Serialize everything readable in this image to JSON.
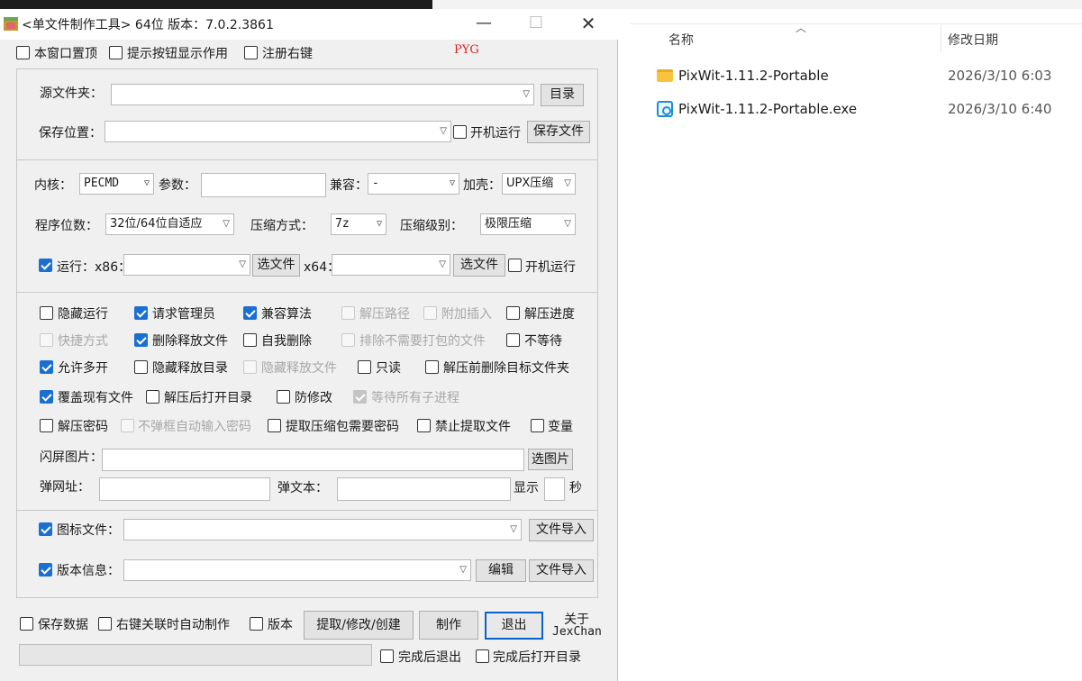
{
  "window": {
    "title": "<单文件制作工具> 64位 版本：7.0.2.3861",
    "brand_mark": "PYG"
  },
  "top_options": {
    "always_on_top": {
      "label": "本窗口置顶",
      "checked": false
    },
    "show_tips": {
      "label": "提示按钮显示作用",
      "checked": false
    },
    "register_context": {
      "label": "注册右键",
      "checked": false
    }
  },
  "source": {
    "source_folder_label": "源文件夹：",
    "source_folder_value": "",
    "dir_button": "目录",
    "save_location_label": "保存位置：",
    "save_location_value": "",
    "autorun_label": "开机运行",
    "save_file_button": "保存文件"
  },
  "settings": {
    "kernel_label": "内核：",
    "kernel_value": "PECMD",
    "params_label": "参数：",
    "compat_label": "兼容：",
    "compat_value": "-",
    "pack_label": "加壳：",
    "pack_value": "UPX压缩",
    "bits_label": "程序位数：",
    "bits_value": "32位/64位自适应",
    "compress_method_label": "压缩方式：",
    "compress_method_value": "7z",
    "compress_level_label": "压缩级别：",
    "compress_level_value": "极限压缩",
    "run_label": "运行：x86：",
    "run_checked": true,
    "choose_file_x86": "选文件",
    "x64_label": "x64：",
    "choose_file_x64": "选文件",
    "boot_run_label": "开机运行"
  },
  "options": {
    "row1": [
      {
        "label": "隐藏运行",
        "state": "off"
      },
      {
        "label": "请求管理员",
        "state": "on"
      },
      {
        "label": "兼容算法",
        "state": "on"
      },
      {
        "label": "解压路径",
        "state": "disabled"
      },
      {
        "label": "附加插入",
        "state": "disabled"
      },
      {
        "label": "解压进度",
        "state": "off"
      }
    ],
    "row2": [
      {
        "label": "快捷方式",
        "state": "disabled"
      },
      {
        "label": "删除释放文件",
        "state": "on"
      },
      {
        "label": "自我删除",
        "state": "off"
      },
      {
        "label": "排除不需要打包的文件",
        "state": "disabled"
      },
      {
        "label": "不等待",
        "state": "off"
      }
    ],
    "row3": [
      {
        "label": "允许多开",
        "state": "on"
      },
      {
        "label": "隐藏释放目录",
        "state": "off"
      },
      {
        "label": "隐藏释放文件",
        "state": "disabled"
      },
      {
        "label": "只读",
        "state": "off"
      },
      {
        "label": "解压前删除目标文件夹",
        "state": "off"
      }
    ],
    "row4": [
      {
        "label": "覆盖现有文件",
        "state": "on"
      },
      {
        "label": "解压后打开目录",
        "state": "off"
      },
      {
        "label": "防修改",
        "state": "off"
      },
      {
        "label": "等待所有子进程",
        "state": "disabled-on"
      }
    ],
    "row5": [
      {
        "label": "解压密码",
        "state": "off"
      },
      {
        "label": "不弹框自动输入密码",
        "state": "disabled"
      },
      {
        "label": "提取压缩包需要密码",
        "state": "off"
      },
      {
        "label": "禁止提取文件",
        "state": "off"
      },
      {
        "label": "变量",
        "state": "off"
      }
    ],
    "splash_label": "闪屏图片：",
    "choose_image_button": "选图片",
    "popup_url_label": "弹网址：",
    "popup_text_label": "弹文本：",
    "show_label": "显示",
    "seconds_label": "秒"
  },
  "resources": {
    "icon_file_label": "图标文件：",
    "icon_checked": true,
    "icon_import_button": "文件导入",
    "version_info_label": "版本信息：",
    "version_checked": true,
    "edit_button": "编辑",
    "version_import_button": "文件导入"
  },
  "bottom": {
    "save_data": {
      "label": "保存数据",
      "checked": false
    },
    "auto_make": {
      "label": "右键关联时自动制作",
      "checked": false
    },
    "version": {
      "label": "版本",
      "checked": false
    },
    "extract_button": "提取/修改/创建",
    "make_button": "制作",
    "exit_button": "退出",
    "about_label": "关于",
    "author_label": "JexChan",
    "exit_after": {
      "label": "完成后退出",
      "checked": false
    },
    "open_dir_after": {
      "label": "完成后打开目录",
      "checked": false
    },
    "progress": 0
  },
  "explorer": {
    "column_name": "名称",
    "column_date": "修改日期",
    "files": [
      {
        "name": "PixWit-1.11.2-Portable",
        "date": "2026/3/10 6:03",
        "icon": "folder-icon"
      },
      {
        "name": "PixWit-1.11.2-Portable.exe",
        "date": "2026/3/10 6:40",
        "icon": "exe-icon"
      }
    ]
  }
}
